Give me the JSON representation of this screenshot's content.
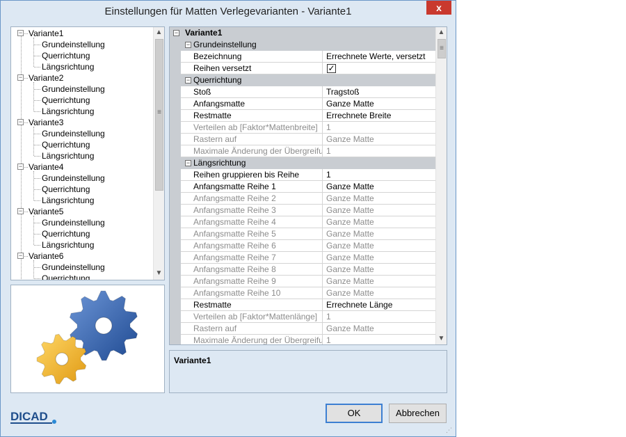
{
  "window": {
    "title": "Einstellungen für Matten Verlegevarianten - Variante1",
    "close_label": "x"
  },
  "tree": {
    "expander": "−",
    "nodes": [
      {
        "label": "Variante1",
        "children": [
          "Grundeinstellung",
          "Querrichtung",
          "Längsrichtung"
        ]
      },
      {
        "label": "Variante2",
        "children": [
          "Grundeinstellung",
          "Querrichtung",
          "Längsrichtung"
        ]
      },
      {
        "label": "Variante3",
        "children": [
          "Grundeinstellung",
          "Querrichtung",
          "Längsrichtung"
        ]
      },
      {
        "label": "Variante4",
        "children": [
          "Grundeinstellung",
          "Querrichtung",
          "Längsrichtung"
        ]
      },
      {
        "label": "Variante5",
        "children": [
          "Grundeinstellung",
          "Querrichtung",
          "Längsrichtung"
        ]
      },
      {
        "label": "Variante6",
        "children": [
          "Grundeinstellung",
          "Querrichtung"
        ]
      }
    ]
  },
  "scroll": {
    "up": "▲",
    "down": "▼",
    "grip": "≡"
  },
  "properties": {
    "expander": "−",
    "root": "Variante1",
    "categories": [
      {
        "label": "Grundeinstellung",
        "rows": [
          {
            "name": "Bezeichnung",
            "value": "Errechnete Werte, versetzt",
            "disabled": false
          },
          {
            "name": "Reihen versetzt",
            "value": "",
            "checked": true,
            "check_glyph": "✓",
            "disabled": false
          }
        ]
      },
      {
        "label": "Querrichtung",
        "rows": [
          {
            "name": "Stoß",
            "value": "Tragstoß",
            "disabled": false
          },
          {
            "name": "Anfangsmatte",
            "value": "Ganze Matte",
            "disabled": false
          },
          {
            "name": "Restmatte",
            "value": "Errechnete Breite",
            "disabled": false
          },
          {
            "name": "Verteilen ab [Faktor*Mattenbreite]",
            "value": "1",
            "disabled": true
          },
          {
            "name": "Rastern auf",
            "value": "Ganze Matte",
            "disabled": true
          },
          {
            "name": "Maximale Änderung der Übergreifu...",
            "value": "1",
            "disabled": true
          }
        ]
      },
      {
        "label": "Längsrichtung",
        "rows": [
          {
            "name": "Reihen gruppieren bis Reihe",
            "value": "1",
            "disabled": false
          },
          {
            "name": "Anfangsmatte Reihe 1",
            "value": "Ganze Matte",
            "disabled": false
          },
          {
            "name": "Anfangsmatte Reihe 2",
            "value": "Ganze Matte",
            "disabled": true
          },
          {
            "name": "Anfangsmatte Reihe 3",
            "value": "Ganze Matte",
            "disabled": true
          },
          {
            "name": "Anfangsmatte Reihe 4",
            "value": "Ganze Matte",
            "disabled": true
          },
          {
            "name": "Anfangsmatte Reihe 5",
            "value": "Ganze Matte",
            "disabled": true
          },
          {
            "name": "Anfangsmatte Reihe 6",
            "value": "Ganze Matte",
            "disabled": true
          },
          {
            "name": "Anfangsmatte Reihe 7",
            "value": "Ganze Matte",
            "disabled": true
          },
          {
            "name": "Anfangsmatte Reihe 8",
            "value": "Ganze Matte",
            "disabled": true
          },
          {
            "name": "Anfangsmatte Reihe 9",
            "value": "Ganze Matte",
            "disabled": true
          },
          {
            "name": "Anfangsmatte Reihe 10",
            "value": "Ganze Matte",
            "disabled": true
          },
          {
            "name": "Restmatte",
            "value": "Errechnete Länge",
            "disabled": false
          },
          {
            "name": "Verteilen ab [Faktor*Mattenlänge]",
            "value": "1",
            "disabled": true
          },
          {
            "name": "Rastern auf",
            "value": "Ganze Matte",
            "disabled": true
          },
          {
            "name": "Maximale Änderung der Übergreifu...",
            "value": "1",
            "disabled": true
          }
        ]
      }
    ]
  },
  "description": {
    "title": "Variante1"
  },
  "logo": {
    "text": "DICAD"
  },
  "buttons": {
    "ok": "OK",
    "cancel": "Abbrechen"
  },
  "colors": {
    "gear_blue": "#2f5fa8",
    "gear_yellow": "#f1b52e",
    "logo_blue": "#1f4e8c"
  }
}
